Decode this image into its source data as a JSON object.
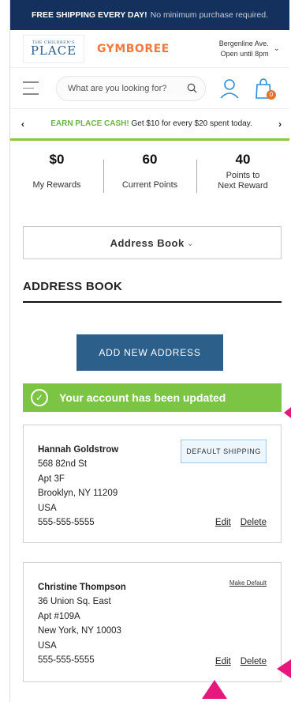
{
  "topbar": {
    "bold": "FREE SHIPPING EVERY DAY!",
    "rest": "No minimum purchase required."
  },
  "brand": {
    "place_small": "THE CHILDREN'S",
    "place_big": "PLACE",
    "gymboree": "GYMBOREE"
  },
  "store": {
    "name": "Bergenline Ave.",
    "hours": "Open until 8pm"
  },
  "search": {
    "placeholder": "What are you looking for?"
  },
  "cart": {
    "count": "0"
  },
  "promo": {
    "highlight": "EARN PLACE CASH!",
    "text": "Get $10 for every $20 spent today."
  },
  "rewards": [
    {
      "value": "$0",
      "label": "My Rewards"
    },
    {
      "value": "60",
      "label": "Current Points"
    },
    {
      "value": "40",
      "label_line1": "Points to",
      "label_line2": "Next Reward"
    }
  ],
  "dropdown": {
    "label": "Address Book"
  },
  "section": {
    "title": "ADDRESS BOOK"
  },
  "add_button": "ADD NEW ADDRESS",
  "success_message": "Your account has been updated",
  "addresses": [
    {
      "name": "Hannah Goldstrow",
      "line1": "568 82nd St",
      "line2": "Apt 3F",
      "city": "Brooklyn, NY 11209",
      "country": "USA",
      "phone": "555-555-5555",
      "badge": "DEFAULT SHIPPING",
      "edit": "Edit",
      "delete": "Delete"
    },
    {
      "name": "Christine Thompson",
      "line1": "36 Union Sq. East",
      "line2": "Apt #109A",
      "city": "New York, NY 10003",
      "country": "USA",
      "phone": "555-555-5555",
      "make_default": "Make Default",
      "edit": "Edit",
      "delete": "Delete"
    }
  ],
  "colors": {
    "navy": "#14315d",
    "button": "#2c5f8a",
    "success": "#7cc443",
    "promo_green": "#6db33f",
    "pointer": "#e6177d",
    "accent_orange": "#e8722a"
  }
}
